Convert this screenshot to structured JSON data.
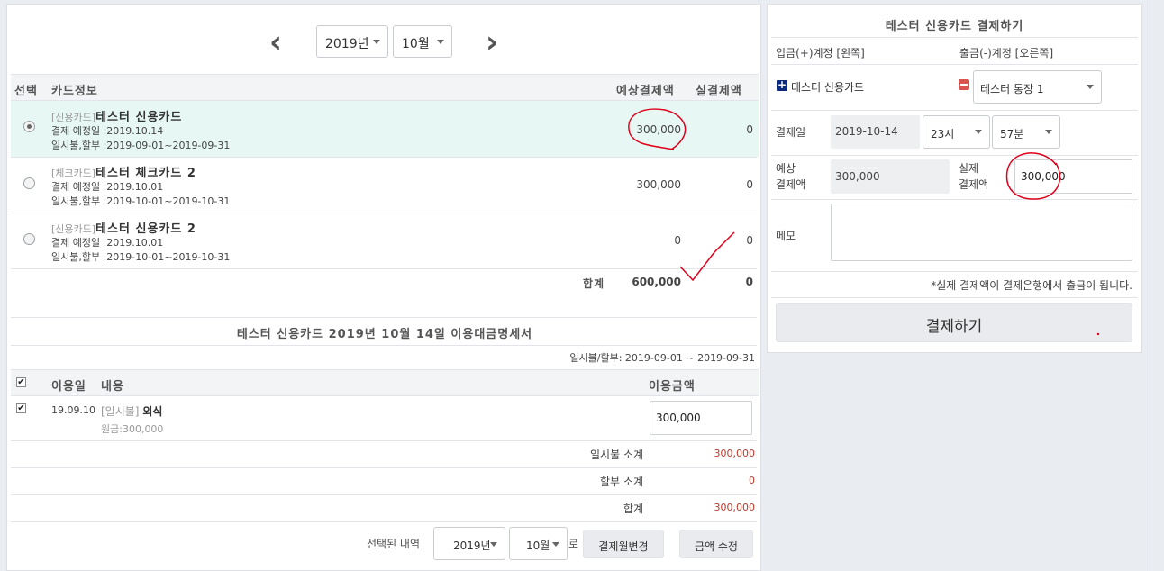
{
  "month_nav": {
    "year": "2019년",
    "month": "10월"
  },
  "card_table": {
    "headers": {
      "select": "선택",
      "card_info": "카드정보",
      "expected": "예상결제액",
      "actual": "실결제액"
    },
    "rows": [
      {
        "type": "[신용카드]",
        "name": "테스터 신용카드",
        "due": "결제 예정일   :2019.10.14",
        "period": "일시불,할부   :2019-09-01~2019-09-31",
        "expected": "300,000",
        "actual": "0",
        "selected": true
      },
      {
        "type": "[체크카드]",
        "name": "테스터 체크카드 2",
        "due": "결제 예정일   :2019.10.01",
        "period": "일시불,할부   :2019-10-01~2019-10-31",
        "expected": "300,000",
        "actual": "0",
        "selected": false
      },
      {
        "type": "[신용카드]",
        "name": "테스터 신용카드 2",
        "due": "결제 예정일   :2019.10.01",
        "period": "일시불,할부   :2019-10-01~2019-10-31",
        "expected": "0",
        "actual": "0",
        "selected": false
      }
    ],
    "total": {
      "label": "합계",
      "expected": "600,000",
      "actual": "0"
    }
  },
  "statement": {
    "title": "테스터 신용카드 2019년 10월 14일 이용대금명세서",
    "period": "일시불/할부: 2019-09-01 ~ 2019-09-31",
    "headers": {
      "date": "이용일",
      "content": "내용",
      "amount": "이용금액"
    },
    "items": [
      {
        "date": "19.09.10",
        "tag": "[일시불]",
        "name": "외식",
        "original": "원금:300,000",
        "amount": "300,000"
      }
    ],
    "subtotals": [
      {
        "label": "일시불 소계",
        "value": "300,000"
      },
      {
        "label": "할부 소계",
        "value": "0"
      },
      {
        "label": "합계",
        "value": "300,000"
      }
    ],
    "footer": {
      "selected_label": "선택된 내역",
      "year": "2019년",
      "month": "10월",
      "to": "로",
      "change_month_button": "결제월변경",
      "edit_amount_button": "금액 수정"
    }
  },
  "payment": {
    "title": "테스터 신용카드 결제하기",
    "in_account_label": "입금(+)계정 [왼쪽]",
    "out_account_label": "출금(-)계정 [오른쪽]",
    "in_account": "테스터 신용카드",
    "out_account": "테스터 통장 1",
    "date_label": "결제일",
    "date_value": "2019-10-14",
    "hour": "23시",
    "minute": "57분",
    "expected_label_1": "예상",
    "expected_label_2": "결제액",
    "expected_value": "300,000",
    "actual_label_1": "실제",
    "actual_label_2": "결제액",
    "actual_value": "300,000",
    "memo_label": "메모",
    "memo_value": "",
    "note": "*실제 결제액이 결제은행에서 출금이 됩니다.",
    "pay_button": "결제하기"
  },
  "colors": {
    "selected_row": "#e7f8f4",
    "accent_red": "#c0392b",
    "ink": "#e0001a"
  }
}
